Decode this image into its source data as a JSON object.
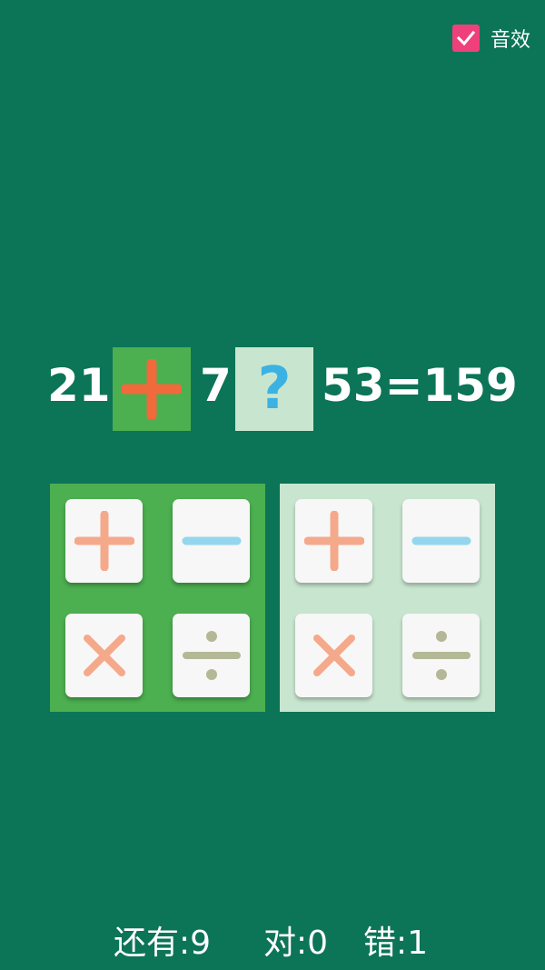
{
  "sound": {
    "label": "音效",
    "checked": true,
    "check_color": "#f0407b"
  },
  "equation": {
    "a": "21",
    "op1": "plus",
    "b": "7",
    "op2_placeholder": "?",
    "rest": "53=159"
  },
  "keypads": {
    "left": [
      "plus",
      "minus",
      "multiply",
      "divide"
    ],
    "right": [
      "plus",
      "minus",
      "multiply",
      "divide"
    ]
  },
  "score": {
    "remaining": "还有:9",
    "correct": "对:0",
    "wrong": "错:1"
  },
  "colors": {
    "background": "#0c7457",
    "slot_filled": "#4caf50",
    "slot_empty": "#c8e6cf",
    "plus": "#f5a98b",
    "minus": "#93d6ee",
    "multiply": "#f5a98b",
    "divide": "#b5b896",
    "selected_plus": "#f06a3c",
    "question_mark": "#3cb2e3"
  }
}
